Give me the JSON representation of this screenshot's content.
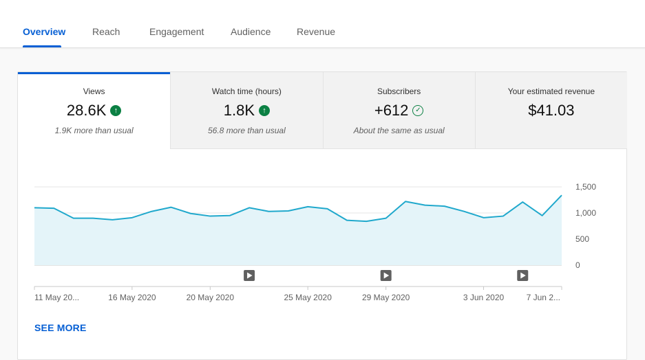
{
  "tabs": [
    {
      "label": "Overview",
      "active": true
    },
    {
      "label": "Reach",
      "active": false
    },
    {
      "label": "Engagement",
      "active": false
    },
    {
      "label": "Audience",
      "active": false
    },
    {
      "label": "Revenue",
      "active": false
    }
  ],
  "metrics": [
    {
      "label": "Views",
      "value": "28.6K",
      "icon": "arrow-up-circle-icon",
      "note": "1.9K more than usual"
    },
    {
      "label": "Watch time (hours)",
      "value": "1.8K",
      "icon": "arrow-up-circle-icon",
      "note": "56.8 more than usual"
    },
    {
      "label": "Subscribers",
      "value": "+612",
      "icon": "check-circle-icon",
      "note": "About the same as usual"
    },
    {
      "label": "Your estimated revenue",
      "value": "$41.03",
      "note": ""
    }
  ],
  "colors": {
    "accent": "#065fd4",
    "line": "#1fa8cc",
    "fill": "#e4f4f9",
    "positive": "#0b8043"
  },
  "see_more": "SEE MORE",
  "chart_data": {
    "type": "area",
    "series": [
      {
        "values": [
          1100,
          1090,
          900,
          900,
          870,
          910,
          1030,
          1110,
          990,
          940,
          950,
          1100,
          1030,
          1040,
          1120,
          1080,
          860,
          840,
          900,
          1220,
          1150,
          1130,
          1030,
          910,
          940,
          1210,
          950,
          1340
        ]
      }
    ],
    "ylim": [
      0,
      1500
    ],
    "yticks": [
      "1,500",
      "1,000",
      "500",
      "0"
    ],
    "xticks": [
      {
        "index": 0,
        "label": "11 May 20..."
      },
      {
        "index": 5,
        "label": "16 May 2020"
      },
      {
        "index": 9,
        "label": "20 May 2020"
      },
      {
        "index": 14,
        "label": "25 May 2020"
      },
      {
        "index": 18,
        "label": "29 May 2020"
      },
      {
        "index": 23,
        "label": "3 Jun 2020"
      },
      {
        "index": 27,
        "label": "7 Jun 2..."
      }
    ],
    "video_markers": [
      11,
      18,
      25
    ],
    "grid": true
  }
}
